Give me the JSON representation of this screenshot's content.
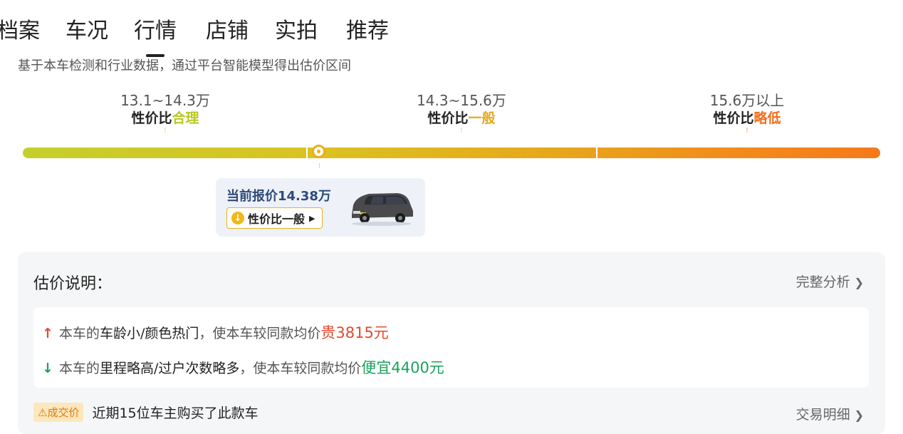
{
  "tabs": [
    {
      "label": "档案"
    },
    {
      "label": "车况"
    },
    {
      "label": "行情"
    },
    {
      "label": "店铺"
    },
    {
      "label": "实拍"
    },
    {
      "label": "推荐"
    }
  ],
  "active_tab": 2,
  "subtitle": "基于本车检测和行业数据，通过平台智能模型得出估价区间",
  "segments": [
    {
      "range": "13.1~14.3万",
      "label_prefix": "性价比",
      "label_level": "合理",
      "level_color": "#b8c81f"
    },
    {
      "range": "14.3~15.6万",
      "label_prefix": "性价比",
      "label_level": "一般",
      "level_color": "#e6a91b"
    },
    {
      "range": "15.6万以上",
      "label_prefix": "性价比",
      "label_level": "略低",
      "level_color": "#f26d1b"
    }
  ],
  "current": {
    "price_text": "当前报价14.38万",
    "tag_text": "性价比一般",
    "tag_icon": "arrow-down-circle-icon",
    "marker_color": "#e6b21a"
  },
  "explain": {
    "title": "估价说明：",
    "full_link": "完整分析",
    "reasons": [
      {
        "icon": "arrow-up-icon",
        "prefix": "本车的",
        "highlight": "车龄小/颜色热门",
        "middle": "，使本车较同款均价",
        "delta": "贵3815元",
        "color": "#e24a2b"
      },
      {
        "icon": "arrow-down-icon",
        "prefix": "本车的",
        "highlight": "里程略高/过户次数略多",
        "middle": "，使本车较同款均价",
        "delta": "便宜4400元",
        "color": "#18a35c"
      }
    ]
  },
  "deal": {
    "badge": "成交价",
    "text": "近期15位车主购买了此款车",
    "link": "交易明细"
  }
}
